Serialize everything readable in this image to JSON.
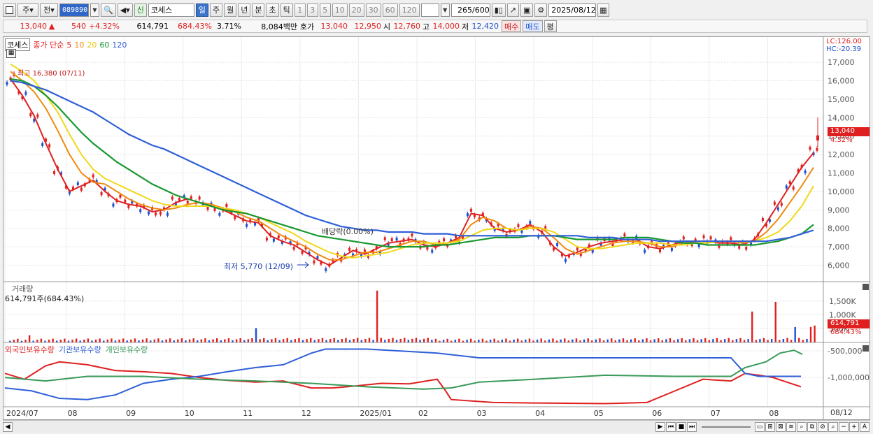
{
  "toolbar": {
    "chart_type": "주",
    "prev_label": "전",
    "stock_code": "089890",
    "new_badge": "신",
    "stock_name": "코세스",
    "periods": [
      "일",
      "주",
      "월",
      "년",
      "분",
      "초",
      "틱"
    ],
    "active_period": "일",
    "intervals": [
      "1",
      "3",
      "5",
      "10",
      "20",
      "30",
      "60",
      "120"
    ],
    "range_value": "265",
    "range_total": "/600",
    "date": "2025/08/12"
  },
  "quote": {
    "price": "13,040",
    "arrow": "▲",
    "change": "540",
    "change_pct": "+4.32%",
    "volume": "614,791",
    "vol_ratio": "684.43%",
    "turnover": "3.71%",
    "amount": "8,084백만",
    "bid_label": "호가",
    "bid1": "13,040",
    "bid2": "12,950",
    "open_label": "시",
    "open": "12,760",
    "high_label": "고",
    "high": "14,000",
    "low_label": "저",
    "low": "12,420",
    "buy_btn": "매수",
    "sell_btn": "매도",
    "eval_btn": "평"
  },
  "legend": {
    "name": "코세스",
    "ma_title": "종가 단순",
    "ma_periods": [
      "5",
      "10",
      "20",
      "60",
      "120"
    ],
    "ma_colors": [
      "#e02020",
      "#f08a10",
      "#f0d818",
      "#189830",
      "#2f5fd8"
    ]
  },
  "price_panel": {
    "lc": "LC:126.00",
    "hc": "HC:-20.39",
    "y_ticks": [
      "17,000",
      "16,000",
      "15,000",
      "14,000",
      "13,000",
      "12,000",
      "11,000",
      "10,000",
      "9,000",
      "8,000",
      "7,000",
      "6,000"
    ],
    "last_price_tag": "13,040",
    "last_pct_tag": "4.32%",
    "high_note": "최고 16,380 (07/11)",
    "low_note": "최저 5,770 (12/09)",
    "dividend_note": "배당락(0.00%)"
  },
  "volume_panel": {
    "title": "거래량",
    "sub": "614,791주(684.43%)",
    "y_ticks": [
      "1,500K",
      "1,000K",
      "500K"
    ],
    "last_tag": "614,791",
    "last_pct": "684.43%"
  },
  "holding_panel": {
    "s1": "외국인보유수량",
    "s2": "기관보유수량",
    "s3": "개인보유수량",
    "y_ticks": [
      "-500,000",
      "-1,000,000"
    ]
  },
  "x_axis": {
    "labels": [
      "2024/07",
      "08",
      "09",
      "10",
      "11",
      "12",
      "2025/01",
      "02",
      "03",
      "04",
      "05",
      "06",
      "07",
      "08"
    ],
    "right_label": "08/12"
  },
  "colors": {
    "up": "#e02020",
    "down": "#1f4fd0",
    "foreign": "#e02020",
    "inst": "#2f5fd8",
    "indiv": "#3a9a5a"
  },
  "chart_data": {
    "type": "line",
    "title": "",
    "series": [
      {
        "name": "종가 단순 5",
        "values": [
          16100,
          15200,
          14100,
          12600,
          11200,
          10000,
          10300,
          10600,
          10000,
          9500,
          9300,
          9200,
          8900,
          9000,
          9400,
          9600,
          9400,
          9200,
          9000,
          8700,
          8400,
          8300,
          7600,
          7300,
          7100,
          6700,
          6300,
          6000,
          6400,
          6800,
          6600,
          6900,
          7200,
          7300,
          7400,
          7100,
          7000,
          7200,
          7500,
          8800,
          8700,
          8000,
          7800,
          7900,
          8200,
          7800,
          7000,
          6500,
          6700,
          7000,
          7200,
          7300,
          7400,
          7400,
          7000,
          6900,
          7100,
          7300,
          7300,
          7300,
          7200,
          7200,
          7100,
          7400,
          8300,
          9300,
          10300,
          11300,
          12100
        ]
      },
      {
        "name": "종가 단순 10",
        "values": [
          16500,
          16000,
          15400,
          14500,
          13300,
          12000,
          11000,
          10500,
          10400,
          10000,
          9600,
          9300,
          9100,
          9000,
          9100,
          9300,
          9400,
          9300,
          9100,
          8900,
          8600,
          8400,
          8000,
          7600,
          7300,
          7000,
          6600,
          6300,
          6300,
          6500,
          6700,
          6700,
          6900,
          7100,
          7300,
          7300,
          7100,
          7200,
          7400,
          8200,
          8600,
          8400,
          8000,
          7900,
          8100,
          8000,
          7500,
          6900,
          6600,
          6800,
          7000,
          7200,
          7300,
          7300,
          7200,
          7000,
          7000,
          7200,
          7300,
          7300,
          7300,
          7300,
          7200,
          7300,
          7800,
          8500,
          9400,
          10300,
          11300
        ]
      },
      {
        "name": "종가 단순 20",
        "values": [
          16900,
          16500,
          16000,
          15200,
          14300,
          13100,
          12000,
          11200,
          10700,
          10400,
          10100,
          9800,
          9500,
          9300,
          9200,
          9200,
          9200,
          9200,
          9100,
          9000,
          8800,
          8600,
          8300,
          8000,
          7700,
          7300,
          7000,
          6700,
          6500,
          6400,
          6500,
          6600,
          6700,
          6900,
          7100,
          7200,
          7200,
          7200,
          7300,
          7600,
          7900,
          8000,
          8000,
          7900,
          8000,
          8000,
          7800,
          7400,
          7000,
          6900,
          6900,
          7000,
          7100,
          7200,
          7200,
          7200,
          7100,
          7100,
          7200,
          7200,
          7300,
          7300,
          7300,
          7300,
          7500,
          7800,
          8400,
          9200,
          10300
        ]
      },
      {
        "name": "종가 단순 60",
        "values": [
          16100,
          16000,
          15700,
          15200,
          14600,
          13900,
          13200,
          12600,
          12100,
          11600,
          11200,
          10800,
          10400,
          10100,
          9800,
          9600,
          9400,
          9200,
          9000,
          8900,
          8800,
          8600,
          8400,
          8200,
          8000,
          7800,
          7600,
          7500,
          7400,
          7300,
          7200,
          7100,
          7000,
          7000,
          7000,
          7000,
          7100,
          7100,
          7200,
          7300,
          7400,
          7500,
          7500,
          7500,
          7600,
          7600,
          7600,
          7500,
          7400,
          7400,
          7400,
          7400,
          7500,
          7500,
          7500,
          7400,
          7300,
          7200,
          7200,
          7100,
          7100,
          7100,
          7100,
          7100,
          7200,
          7300,
          7500,
          7700,
          8200
        ]
      },
      {
        "name": "종가 단순 120",
        "values": [
          16000,
          15900,
          15700,
          15500,
          15200,
          14900,
          14600,
          14300,
          13900,
          13500,
          13100,
          12800,
          12500,
          12300,
          12000,
          11700,
          11400,
          11100,
          10800,
          10500,
          10200,
          9900,
          9600,
          9300,
          9000,
          8700,
          8500,
          8300,
          8100,
          8000,
          7900,
          7900,
          7800,
          7800,
          7800,
          7700,
          7700,
          7700,
          7600,
          7600,
          7600,
          7600,
          7600,
          7600,
          7600,
          7600,
          7600,
          7600,
          7600,
          7500,
          7500,
          7500,
          7400,
          7400,
          7400,
          7300,
          7300,
          7300,
          7300,
          7300,
          7300,
          7300,
          7300,
          7300,
          7300,
          7400,
          7500,
          7700,
          7900
        ]
      }
    ],
    "ylim": [
      5300,
      17800
    ],
    "ylabel": "",
    "xlabel": ""
  }
}
